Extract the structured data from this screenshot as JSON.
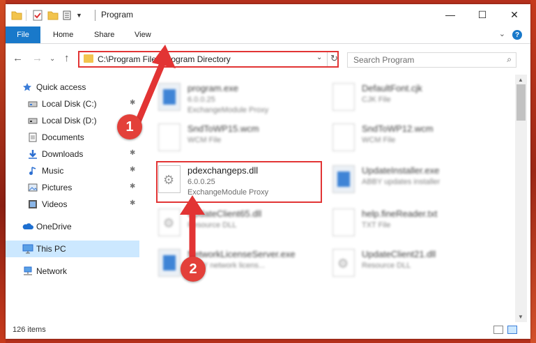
{
  "window": {
    "title": "Program",
    "minimize_glyph": "—",
    "maximize_glyph": "☐",
    "close_glyph": "✕"
  },
  "ribbon": {
    "file": "File",
    "tabs": [
      "Home",
      "Share",
      "View"
    ],
    "help": "?",
    "expand": "⌄"
  },
  "nav": {
    "back": "←",
    "forward": "→",
    "recent": "⌄",
    "up": "↑",
    "address": "C:\\Program Files\\Program Directory",
    "address_drop": "⌄",
    "refresh": "↻",
    "search_placeholder": "Search Program",
    "search_glyph": "⌕"
  },
  "sidebar": {
    "items": [
      {
        "label": "Quick access",
        "icon": "star-icon",
        "pinned": false
      },
      {
        "label": "Local Disk (C:)",
        "icon": "drive-icon",
        "pinned": true
      },
      {
        "label": "Local Disk (D:)",
        "icon": "drive-icon",
        "pinned": true
      },
      {
        "label": "Documents",
        "icon": "documents-icon",
        "pinned": true
      },
      {
        "label": "Downloads",
        "icon": "download-icon",
        "pinned": true
      },
      {
        "label": "Music",
        "icon": "music-icon",
        "pinned": true
      },
      {
        "label": "Pictures",
        "icon": "pictures-icon",
        "pinned": true
      },
      {
        "label": "Videos",
        "icon": "videos-icon",
        "pinned": true
      },
      {
        "label": "OneDrive",
        "icon": "cloud-icon",
        "pinned": false
      },
      {
        "label": "This PC",
        "icon": "computer-icon",
        "pinned": false,
        "selected": true
      },
      {
        "label": "Network",
        "icon": "network-icon",
        "pinned": false
      }
    ],
    "pin_glyph": "📌"
  },
  "files": [
    {
      "name": "program.exe",
      "line1": "6.0.0.25",
      "line2": "ExchangeModule Proxy",
      "kind": "exe"
    },
    {
      "name": "DefaultFont.cjk",
      "line1": "CJK File",
      "line2": "",
      "kind": "doc"
    },
    {
      "name": "SndToWP15.wcm",
      "line1": "WCM File",
      "line2": "",
      "kind": "doc"
    },
    {
      "name": "SndToWP12.wcm",
      "line1": "WCM File",
      "line2": "",
      "kind": "doc"
    },
    {
      "name": "pdexchangeps.dll",
      "line1": "6.0.0.25",
      "line2": "ExchangeModule Proxy",
      "kind": "gear"
    },
    {
      "name": "UpdateInstaller.exe",
      "line1": "ABBY updates installer",
      "line2": "",
      "kind": "exe"
    },
    {
      "name": "UpdateClient65.dll",
      "line1": "Resource DLL",
      "line2": "",
      "kind": "gear"
    },
    {
      "name": "help.fineReader.txt",
      "line1": "TXT File",
      "line2": "",
      "kind": "doc"
    },
    {
      "name": "NetworkLicenseServer.exe",
      "line1": "ABBY network licens...",
      "line2": "",
      "kind": "exe"
    },
    {
      "name": "UpdateClient21.dll",
      "line1": "Resource DLL",
      "line2": "",
      "kind": "gear"
    }
  ],
  "status": {
    "item_count": "126 items"
  },
  "annotations": {
    "step1": "1",
    "step2": "2",
    "color": "#e23434"
  }
}
